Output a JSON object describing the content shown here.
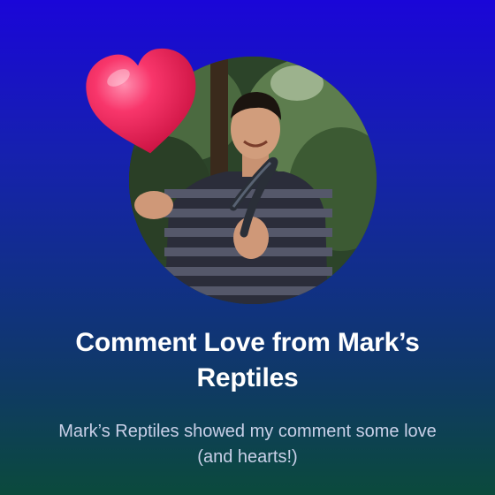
{
  "card": {
    "title": "Comment Love from Mark’s Reptiles",
    "subtitle": "Mark’s Reptiles showed my comment some love (and hearts!)"
  },
  "icons": {
    "heart": "heart-icon",
    "avatar": "profile-photo"
  },
  "colors": {
    "gradient_top": "#1a06d8",
    "gradient_bottom": "#0b4a3c",
    "heart": "#f0245a",
    "title_text": "#ffffff",
    "subtitle_text": "#c9d0e8"
  }
}
